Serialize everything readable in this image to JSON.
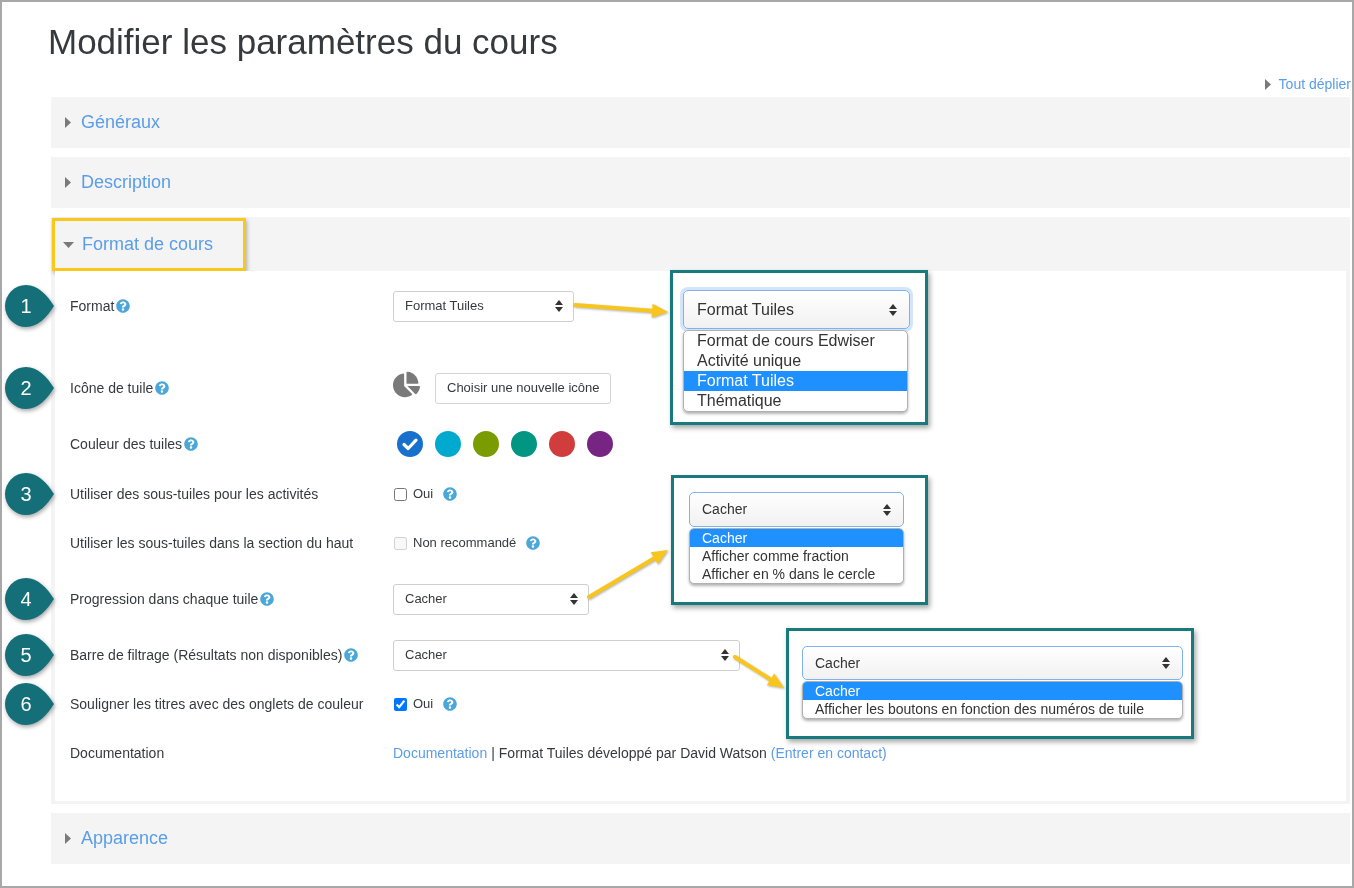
{
  "page": {
    "title": "Modifier les paramètres du cours",
    "expand_all": "Tout déplier"
  },
  "sections": [
    {
      "title": "Généraux",
      "expanded": false,
      "highlighted": false
    },
    {
      "title": "Description",
      "expanded": false,
      "highlighted": false
    },
    {
      "title": "Format de cours",
      "expanded": true,
      "highlighted": true,
      "fields": [
        {
          "kind": "select",
          "step": "1",
          "label": "Format",
          "help": true,
          "value": "Format Tuiles"
        },
        {
          "kind": "icon_picker",
          "step": "2",
          "label": "Icône de tuile",
          "help": true,
          "button": "Choisir une nouvelle icône"
        },
        {
          "kind": "colors",
          "label": "Couleur des tuiles",
          "help": true,
          "swatches": [
            {
              "color": "#1670cc",
              "selected": true
            },
            {
              "color": "#00a9ce",
              "selected": false
            },
            {
              "color": "#7a9c01",
              "selected": false
            },
            {
              "color": "#009681",
              "selected": false
            },
            {
              "color": "#d13c3c",
              "selected": false
            },
            {
              "color": "#772583",
              "selected": false
            }
          ]
        },
        {
          "kind": "checkbox",
          "step": "3",
          "label": "Utiliser des sous-tuiles pour les activités",
          "option": "Oui",
          "checked": false,
          "disabled": false,
          "help": true
        },
        {
          "kind": "checkbox",
          "label": "Utiliser les sous-tuiles dans la section du haut",
          "option": "Non recommandé",
          "checked": false,
          "disabled": true,
          "help": true
        },
        {
          "kind": "select",
          "step": "4",
          "label": "Progression dans chaque tuile",
          "help": true,
          "value": "Cacher"
        },
        {
          "kind": "select",
          "step": "5",
          "label": "Barre de filtrage (Résultats non disponibles)",
          "help": true,
          "value": "Cacher"
        },
        {
          "kind": "checkbox",
          "step": "6",
          "label": "Souligner les titres avec des onglets de couleur",
          "option": "Oui",
          "checked": true,
          "disabled": false,
          "help": true
        },
        {
          "kind": "links",
          "label": "Documentation",
          "parts": [
            {
              "kind": "link",
              "text": "Documentation"
            },
            {
              "kind": "separator",
              "text": "|"
            },
            {
              "kind": "text",
              "text": "Format Tuiles développé par David Watson"
            },
            {
              "kind": "link",
              "text": "(Entrer en contact)"
            }
          ]
        }
      ]
    },
    {
      "title": "Apparence",
      "expanded": false,
      "highlighted": false
    }
  ],
  "callouts": [
    {
      "value": "Format Tuiles",
      "options": [
        {
          "label": "Format de cours Edwiser",
          "selected": false
        },
        {
          "label": "Activité unique",
          "selected": false
        },
        {
          "label": "Format Tuiles",
          "selected": true
        },
        {
          "label": "Thématique",
          "selected": false
        }
      ]
    },
    {
      "value": "Cacher",
      "options": [
        {
          "label": "Cacher",
          "selected": true
        },
        {
          "label": "Afficher comme fraction",
          "selected": false
        },
        {
          "label": "Afficher en % dans le cercle",
          "selected": false
        }
      ]
    },
    {
      "value": "Cacher",
      "options": [
        {
          "label": "Cacher",
          "selected": true
        },
        {
          "label": "Afficher les boutons en fonction des numéros de tuile",
          "selected": false
        }
      ]
    }
  ]
}
